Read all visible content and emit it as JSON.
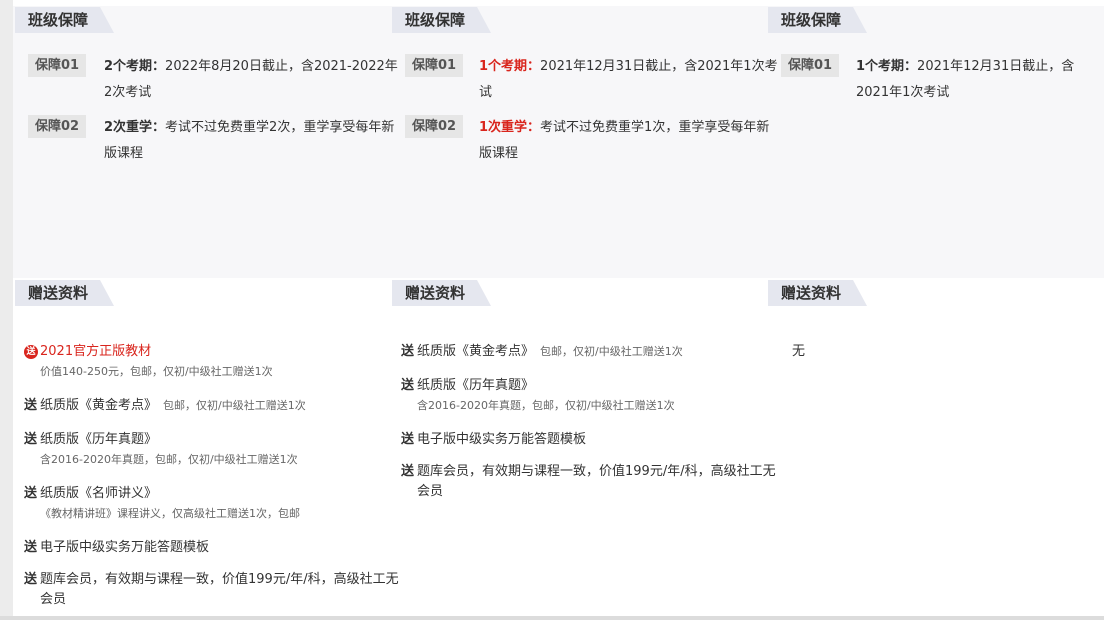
{
  "columns": [
    {
      "guarantee_title": "班级保障",
      "guarantees": [
        {
          "tag": "保障01",
          "key": "2个考期：",
          "text": "2022年8月20日截止，含2021-2022年2次考试",
          "highlight": false
        },
        {
          "tag": "保障02",
          "key": "2次重学：",
          "text": "考试不过免费重学2次，重学享受每年新版课程",
          "highlight": false
        }
      ],
      "gift_title": "赠送资料",
      "gifts": [
        {
          "prefix": "送",
          "title": "2021官方正版教材",
          "inline_note": "",
          "note": "价值140-250元，包邮，仅初/中级社工赠送1次",
          "red": true
        },
        {
          "prefix": "送",
          "title": "纸质版《黄金考点》",
          "inline_note": "包邮，仅初/中级社工赠送1次",
          "note": "",
          "red": false
        },
        {
          "prefix": "送",
          "title": "纸质版《历年真题》",
          "inline_note": "",
          "note": "含2016-2020年真题，包邮，仅初/中级社工赠送1次",
          "red": false
        },
        {
          "prefix": "送",
          "title": "纸质版《名师讲义》",
          "inline_note": "",
          "note": "《教材精讲班》课程讲义，仅高级社工赠送1次，包邮",
          "red": false
        },
        {
          "prefix": "送",
          "title": "电子版中级实务万能答题模板",
          "inline_note": "",
          "note": "",
          "red": false
        },
        {
          "prefix": "送",
          "title": "题库会员，有效期与课程一致，价值199元/年/科，高级社工无会员",
          "inline_note": "",
          "note": "",
          "red": false
        }
      ]
    },
    {
      "guarantee_title": "班级保障",
      "guarantees": [
        {
          "tag": "保障01",
          "key": "1个考期：",
          "text": "2021年12月31日截止，含2021年1次考试",
          "highlight": true
        },
        {
          "tag": "保障02",
          "key": "1次重学：",
          "text": "考试不过免费重学1次，重学享受每年新版课程",
          "highlight": true
        }
      ],
      "gift_title": "赠送资料",
      "gifts": [
        {
          "prefix": "送",
          "title": "纸质版《黄金考点》",
          "inline_note": "包邮，仅初/中级社工赠送1次",
          "note": "",
          "red": false
        },
        {
          "prefix": "送",
          "title": "纸质版《历年真题》",
          "inline_note": "",
          "note": "含2016-2020年真题，包邮，仅初/中级社工赠送1次",
          "red": false
        },
        {
          "prefix": "送",
          "title": "电子版中级实务万能答题模板",
          "inline_note": "",
          "note": "",
          "red": false
        },
        {
          "prefix": "送",
          "title": "题库会员，有效期与课程一致，价值199元/年/科，高级社工无会员",
          "inline_note": "",
          "note": "",
          "red": false
        }
      ]
    },
    {
      "guarantee_title": "班级保障",
      "guarantees": [
        {
          "tag": "保障01",
          "key": "1个考期：",
          "text": "2021年12月31日截止，含2021年1次考试",
          "highlight": false
        }
      ],
      "gift_title": "赠送资料",
      "gifts": [],
      "none_text": "无"
    }
  ]
}
